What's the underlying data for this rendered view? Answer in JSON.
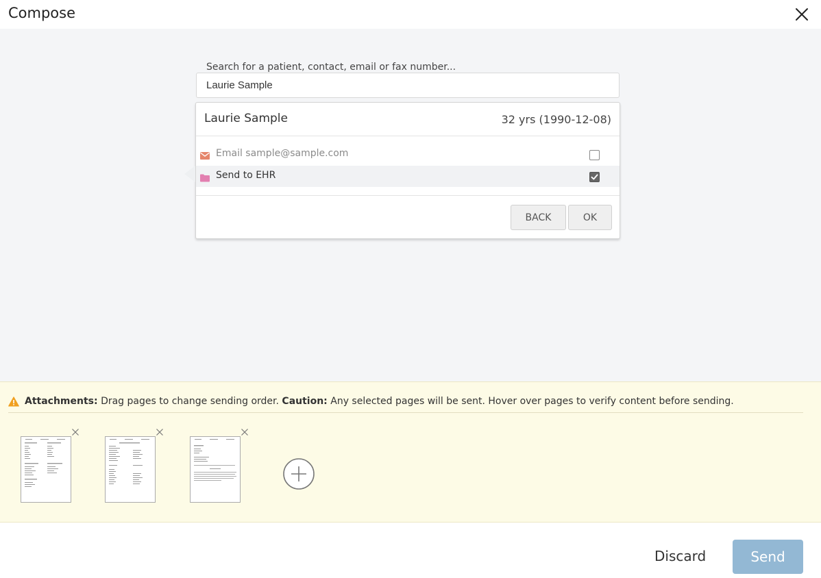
{
  "header": {
    "title": "Compose"
  },
  "search": {
    "label": "Search for a patient, contact, email or fax number...",
    "value": "Laurie Sample"
  },
  "patient": {
    "name": "Laurie Sample",
    "age_dob": "32 yrs (1990-12-08)",
    "options": [
      {
        "label": "Email sample@sample.com",
        "icon": "envelope-icon",
        "checked": false,
        "icon_color": "#e5866b"
      },
      {
        "label": "Send to EHR",
        "icon": "folder-icon",
        "checked": true,
        "icon_color": "#e27fb0"
      }
    ],
    "back_label": "BACK",
    "ok_label": "OK"
  },
  "attachments": {
    "heading": "Attachments:",
    "instructions": "Drag pages to change sending order.",
    "caution_heading": "Caution:",
    "caution_text": "Any selected pages will be sent. Hover over pages to verify content before sending.",
    "page_count": 3
  },
  "footer": {
    "discard_label": "Discard",
    "send_label": "Send"
  },
  "colors": {
    "send_button": "#93b8d4",
    "attachments_bg": "#fdfbe6",
    "warning": "#f0a020",
    "main_bg": "#f4f5f7"
  }
}
